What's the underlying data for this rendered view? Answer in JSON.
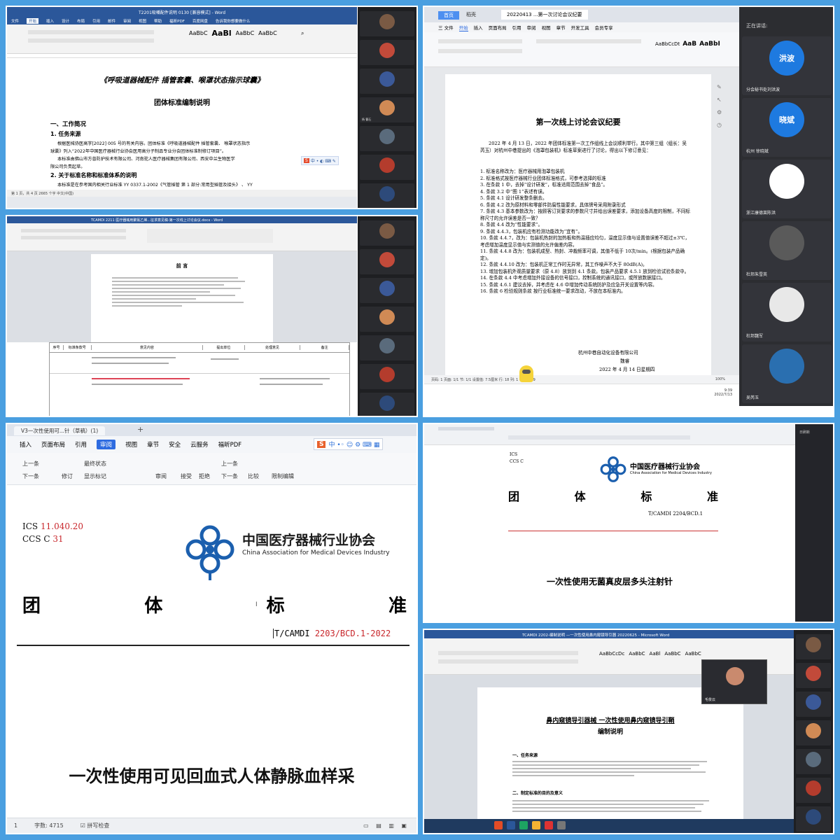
{
  "p1": {
    "title_bar": "T2201吸嘴配件说明 0130 [兼容模式] - Word",
    "tabs": [
      "文件",
      "开始",
      "插入",
      "设计",
      "布局",
      "引用",
      "邮件",
      "审阅",
      "视图",
      "帮助",
      "福昕PDF",
      "百度网盘",
      "告诉我你想要做什么"
    ],
    "styles": [
      "AaBbC",
      "AaBl",
      "AaBbC",
      "AaBbC"
    ],
    "doc_title": "《呼吸道器械配件  插管套囊、喉罩状态指示球囊》",
    "doc_subtitle": "团体标准编制说明",
    "h1": "一、工作简况",
    "h2": "1.  任务来源",
    "p1": "根据医械协医高字[2022] 005 号的有关内容。团体标准《呼吸道器械配件  插管套囊、  喉罩状态指示",
    "p2": "球囊》列入“2022年中国医疗器械行业协会医用高分子制品专业分会团体标准制修订项目”。",
    "p3": "本标准由佛山市方普防护技术有限公司、河南驼人医疗器械集团有限公司、西安中兰生物医学",
    "p4": "限公司负责起草。",
    "h3": "2.  关于标准名称和标准体系的说明",
    "p5": "本标准是在参考国内相关行业标准 YY 0337.1-2002《气管插管  第 1 部分:常用型插管及接头》 、 YY",
    "status": "第 1 页，共 4 页    2665 个字    中文(中国)",
    "participants": [
      "",
      "",
      "",
      "杨  曹石",
      "",
      "",
      "",
      "",
      "",
      "",
      "",
      ""
    ]
  },
  "p2": {
    "title": "TCAMDI 2211 医疗器械用聚氯乙烯...征求意见稿-第一次线上讨论会议.docx - Word",
    "heading": "前  言",
    "table_header": [
      "序号",
      "标准条款号",
      "意见内容",
      "提出单位",
      "处理意见",
      "备注"
    ]
  },
  "p3": {
    "tab_home": "首页",
    "tab_wps": "稻壳",
    "tab_doc": "20220413 ...第一次讨论会议纪要",
    "menu": [
      "三 文件",
      "开始",
      "插入",
      "页面布局",
      "引用",
      "审阅",
      "视图",
      "章节",
      "开发工具",
      "会员专享"
    ],
    "doc_title": "第一次线上讨论会议纪要",
    "intro": "2022 年 4 月 13 日，2022 年团体标准第一次工作组线上会议顺利举行。其中第三组（组长：吴芮玉）对杭州中巷提出的《泡罩包装机》标准草案进行了讨论，得出以下修订意见：",
    "items": [
      "1.  标准名称改为：医疗器械用泡罩包装机",
      "2.  标准格式按医疗器械行业团体标准格式，可参考选择的标准",
      "3.  在条款 1 中，去掉“设计研发”，标准适用范围去掉“食品”。",
      "4.  条款 3.2 中“图 1”表述有误。",
      "5.  条款 4.1 设计研发整条删去。",
      "6.  条款 4.2 改为原材料和零部件防腐性能要求，具体牌号采用附录形式",
      "7.  条款 4.3 基本参数改为：按顾客订货要求的参数尺寸并给出误差要求，添加设备高度的限制，不同标称尺寸的允许误差是否一致？",
      "8.  条款 4.4 改为“性能要求”。",
      "9.  条款 4.4.3，包装机应有检测功能改为“宜有”。",
      "10.  条款 4.4.7，改为：包装机热封的加热板和热温插应均匀，温度显示值与设置值误差不超过±3℃，考虑增加温度显示值与实测值的允许偏差内容。",
      "11.  条款 4.4.8 改为：包装机成型、热封、冲裁频率可调，其值不低于 10次/min。(根据包装产品确定)。",
      "12.  条款 4.4.10 改为：包装机正常工作时无异常，其工作噪声不大于 80dB(A)。",
      "13.  增加包装机外观质量要求（原 4.8）放到到 4.1 条款。包装产品要求 4.5.1 放到检验试验条款中。",
      "14.  在条款 4.4 中考虑增加外接设备的信号接口，控制系统的通讯接口，或所放数据接口。",
      "15.  条款 4.6.1 建议去掉，并考虑在 4.6 中增加传动系统防护及应急开关设置等内容。",
      "16.  条款 6  检验规则条款  按行业标准统一要求改动，不放在本标准内。"
    ],
    "sign_company": "杭州中巷自动化设备有限公司",
    "sign_role": "魏睿",
    "sign_date": "2022 年 4 月 14 日星期四",
    "status": "页码: 1   页面: 1/1   节: 1/1   设置值: 7.5厘米   行: 18   列: 1   字数: 719",
    "zoom": "100%",
    "clock_time": "9:39",
    "clock_date": "2022/7/13",
    "speaking_label": "正在讲话:",
    "participants": [
      {
        "avatar_text": "洪波",
        "name": "分会秘书处刘洪波",
        "color": "#1e7ae0"
      },
      {
        "avatar_text": "晓斌",
        "name": "杭州  徐晓斌",
        "color": "#1e7ae0"
      },
      {
        "avatar_text": "",
        "name": "浙江康德莱陈洪",
        "color": "#ffffff"
      },
      {
        "avatar_text": "",
        "name": "杜邦朱雪英",
        "color": "#5a5a5a"
      },
      {
        "avatar_text": "",
        "name": "杜邦魏军",
        "color": "#e8e8e8"
      },
      {
        "avatar_text": "",
        "name": "吴芮玉",
        "color": "#2a6fb0"
      }
    ]
  },
  "p4": {
    "tab": "V3一次性使用可...针（草稿）(1)",
    "menu": [
      "插入",
      "页面布局",
      "引用",
      "审阅",
      "视图",
      "章节",
      "安全",
      "云服务",
      "福昕PDF"
    ],
    "menu_active": "审阅",
    "toolbar": [
      "上一条",
      "下一条",
      "修订",
      "最终状态",
      "显示标记",
      "审阅",
      "接受",
      "拒绝",
      "上一条",
      "下一条",
      "比较",
      "限制编辑"
    ],
    "ics_label": "ICS",
    "ics_value": "11.040.20",
    "ccs_label": "CCS C",
    "ccs_value": "31",
    "org_cn": "中国医疗器械行业协会",
    "org_en": "China Association for Medical Devices Industry",
    "std_chars": [
      "团",
      "体",
      "标",
      "准"
    ],
    "std_no_prefix": "T/CAMDI",
    "std_no_value": "2203/BCD.1-2022",
    "doc_title": "一次性使用可见回血式人体静脉血样采",
    "status_left": "1",
    "word_count": "字数: 4715",
    "spell": "拼写检查"
  },
  "p5": {
    "ics": "ICS",
    "ccs": "CCS C",
    "org_cn": "中国医疗器械行业协会",
    "org_en": "China Association for Medical Devices Industry",
    "std_chars": [
      "团",
      "体",
      "标",
      "准"
    ],
    "std_no": "T/CAMDI  2204/BCD.1",
    "doc_title": "一次性使用无菌真皮层多头注射针",
    "side_label": "日刷新"
  },
  "p6": {
    "title_bar": "TCAMDI 2202-编制说明 —一次性使用鼻内窥镜导引器 20220625 - Microsoft Word",
    "doc_title": "鼻内窥镜导引器械  一次性使用鼻内窥镜导引鞘",
    "doc_subtitle": "编制说明",
    "h1": "一、任务来源",
    "h2": "二、制定标准的目的及意义",
    "viewer_name": "毛俊云"
  },
  "colors": {
    "accent": "#2b579a",
    "logo_blue": "#1b5fae",
    "red_text": "#c8262b",
    "frame": "#4a9fe0"
  }
}
